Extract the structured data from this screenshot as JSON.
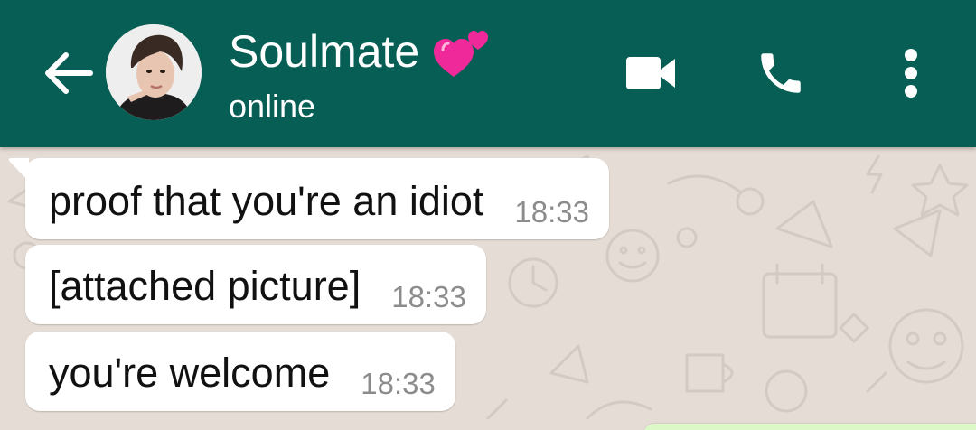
{
  "header": {
    "contact_name": "Soulmate",
    "status": "online",
    "title_emoji": "two-hearts",
    "background_color": "#075e54",
    "text_color": "#ffffff",
    "icons": [
      "back-arrow-icon",
      "video-call-icon",
      "phone-icon",
      "more-options-icon"
    ]
  },
  "chat": {
    "wallpaper_color": "#e5ddd5",
    "incoming_bubble_color": "#ffffff",
    "outgoing_bubble_color": "#dcf8c6",
    "messages": [
      {
        "direction": "incoming",
        "text": "proof that you're an idiot",
        "time": "18:33"
      },
      {
        "direction": "incoming",
        "text": "[attached picture]",
        "time": "18:33"
      },
      {
        "direction": "incoming",
        "text": "you're welcome",
        "time": "18:33"
      }
    ]
  }
}
